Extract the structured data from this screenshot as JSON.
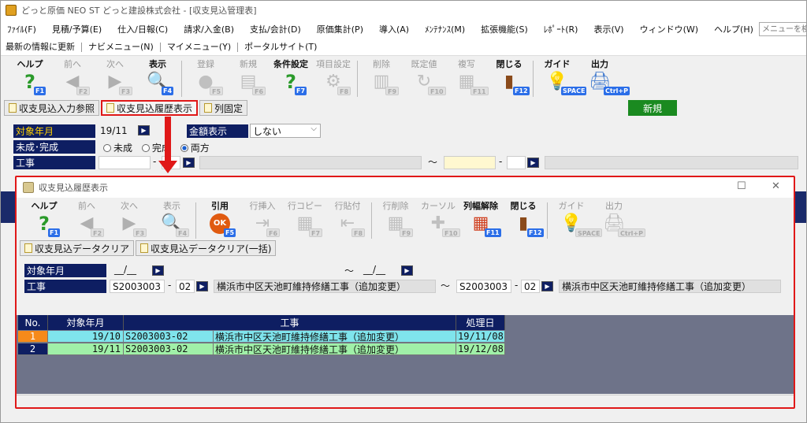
{
  "window": {
    "title": "どっと原価 NEO ST どっと建設株式会社 - [収支見込管理表]"
  },
  "menu": {
    "items": [
      "ﾌｧｲﾙ(F)",
      "見積/予算(E)",
      "仕入/日報(C)",
      "請求/入金(B)",
      "支払/会計(D)",
      "原価集計(P)",
      "導入(A)",
      "ﾒﾝﾃﾅﾝｽ(M)",
      "拡張機能(S)",
      "ﾚﾎﾟｰﾄ(R)",
      "表示(V)",
      "ウィンドウ(W)",
      "ヘルプ(H)"
    ],
    "search_placeholder": "メニューを検索"
  },
  "links": [
    "最新の情報に更新",
    "ナビメニュー(N)",
    "マイメニュー(Y)",
    "ポータルサイト(T)"
  ],
  "main_toolbar": [
    {
      "label": "ヘルプ",
      "key": "F1",
      "icon": "question-icon",
      "glyph": "?",
      "color": "#2a9a2a",
      "enabled": true
    },
    {
      "label": "前へ",
      "key": "F2",
      "icon": "arrow-left-icon",
      "glyph": "◀",
      "color": "#b0b0b0",
      "enabled": false
    },
    {
      "label": "次へ",
      "key": "F3",
      "icon": "arrow-right-icon",
      "glyph": "▶",
      "color": "#b0b0b0",
      "enabled": false
    },
    {
      "label": "表示",
      "key": "F4",
      "icon": "magnifier-icon",
      "glyph": "🔍",
      "color": "#1a60c0",
      "enabled": true
    },
    {
      "label": "登録",
      "key": "F5",
      "icon": "ok-icon",
      "glyph": "●",
      "color": "#c0c0c0",
      "enabled": false
    },
    {
      "label": "新規",
      "key": "F6",
      "icon": "new-doc-icon",
      "glyph": "▤",
      "color": "#c0c0c0",
      "enabled": false
    },
    {
      "label": "条件設定",
      "key": "F7",
      "icon": "condition-icon",
      "glyph": "?",
      "color": "#2a9a2a",
      "enabled": true
    },
    {
      "label": "項目設定",
      "key": "F8",
      "icon": "gear-icon",
      "glyph": "⚙",
      "color": "#c0c0c0",
      "enabled": false
    },
    {
      "label": "削除",
      "key": "F9",
      "icon": "trash-icon",
      "glyph": "▥",
      "color": "#c0c0c0",
      "enabled": false
    },
    {
      "label": "既定値",
      "key": "F10",
      "icon": "refresh-icon",
      "glyph": "↻",
      "color": "#c0c0c0",
      "enabled": false
    },
    {
      "label": "複写",
      "key": "F11",
      "icon": "copy-icon",
      "glyph": "▦",
      "color": "#c0c0c0",
      "enabled": false
    },
    {
      "label": "閉じる",
      "key": "F12",
      "icon": "door-icon",
      "glyph": "▮",
      "color": "#8a4a1a",
      "enabled": true
    },
    {
      "label": "ガイド",
      "key": "SPACE",
      "icon": "lightbulb-icon",
      "glyph": "💡",
      "color": "#e8c020",
      "enabled": true
    },
    {
      "label": "出力",
      "key": "Ctrl+P",
      "icon": "printer-icon",
      "glyph": "🖨",
      "color": "#4a80d0",
      "enabled": true
    }
  ],
  "tabs": [
    {
      "label": "収支見込入力参照",
      "highlighted": false
    },
    {
      "label": "収支見込履歴表示",
      "highlighted": true
    },
    {
      "label": "列固定",
      "highlighted": false
    }
  ],
  "new_badge": "新規",
  "main_form": {
    "target_month_label": "対象年月",
    "target_month_value": "19/11",
    "amount_display_label": "金額表示",
    "amount_display_value": "しない",
    "completion_label": "未成･完成",
    "radio_options": [
      "未成",
      "完成",
      "両方"
    ],
    "radio_selected": 2,
    "construction_label": "工事",
    "dash": "-",
    "tilde": "～"
  },
  "dialog": {
    "title": "収支見込履歴表示",
    "toolbar": [
      {
        "label": "ヘルプ",
        "key": "F1",
        "icon": "question-icon",
        "glyph": "?",
        "color": "#2a9a2a",
        "enabled": true
      },
      {
        "label": "前へ",
        "key": "F2",
        "icon": "arrow-left-icon",
        "glyph": "◀",
        "color": "#b0b0b0",
        "enabled": false
      },
      {
        "label": "次へ",
        "key": "F3",
        "icon": "arrow-right-icon",
        "glyph": "▶",
        "color": "#b0b0b0",
        "enabled": false
      },
      {
        "label": "表示",
        "key": "F4",
        "icon": "magnifier-icon",
        "glyph": "🔍",
        "color": "#c0c0c0",
        "enabled": false
      },
      {
        "label": "引用",
        "key": "F5",
        "icon": "ok-icon",
        "glyph": "OK",
        "color": "#e05a10",
        "enabled": true
      },
      {
        "label": "行挿入",
        "key": "F6",
        "icon": "row-insert-icon",
        "glyph": "⇥",
        "color": "#c0c0c0",
        "enabled": false
      },
      {
        "label": "行コピー",
        "key": "F7",
        "icon": "row-copy-icon",
        "glyph": "▦",
        "color": "#c0c0c0",
        "enabled": false
      },
      {
        "label": "行貼付",
        "key": "F8",
        "icon": "row-paste-icon",
        "glyph": "⇤",
        "color": "#c0c0c0",
        "enabled": false
      },
      {
        "label": "行削除",
        "key": "F9",
        "icon": "row-delete-icon",
        "glyph": "▦",
        "color": "#c0c0c0",
        "enabled": false
      },
      {
        "label": "カーソル",
        "key": "F10",
        "icon": "cursor-icon",
        "glyph": "✚",
        "color": "#c0c0c0",
        "enabled": false
      },
      {
        "label": "列幅解除",
        "key": "F11",
        "icon": "column-width-icon",
        "glyph": "▦",
        "color": "#d04020",
        "enabled": true
      },
      {
        "label": "閉じる",
        "key": "F12",
        "icon": "door-icon",
        "glyph": "▮",
        "color": "#8a4a1a",
        "enabled": true
      },
      {
        "label": "ガイド",
        "key": "SPACE",
        "icon": "lightbulb-icon",
        "glyph": "💡",
        "color": "#c0c0c0",
        "enabled": false
      },
      {
        "label": "出力",
        "key": "Ctrl+P",
        "icon": "printer-icon",
        "glyph": "🖨",
        "color": "#c0c0c0",
        "enabled": false
      }
    ],
    "buttons": [
      "収支見込データクリア",
      "収支見込データクリア(一括)"
    ],
    "target_month_label": "対象年月",
    "month_from": "__/__",
    "month_to": "__/__",
    "construction_label": "工事",
    "code_from": "S2003003",
    "branch_from": "02",
    "name_from": "横浜市中区天池町維持修繕工事（追加変更）",
    "code_to": "S2003003",
    "branch_to": "02",
    "name_to": "横浜市中区天池町維持修繕工事（追加変更）",
    "tilde": "～",
    "dash": "-",
    "grid": {
      "headers": [
        "No.",
        "対象年月",
        "工事",
        "処理日"
      ],
      "rows": [
        {
          "no": "1",
          "month": "19/10",
          "code": "S2003003-02",
          "name": "横浜市中区天池町維持修繕工事（追加変更）",
          "date": "19/11/08"
        },
        {
          "no": "2",
          "month": "19/11",
          "code": "S2003003-02",
          "name": "横浜市中区天池町維持修繕工事（追加変更）",
          "date": "19/12/08"
        }
      ]
    }
  }
}
